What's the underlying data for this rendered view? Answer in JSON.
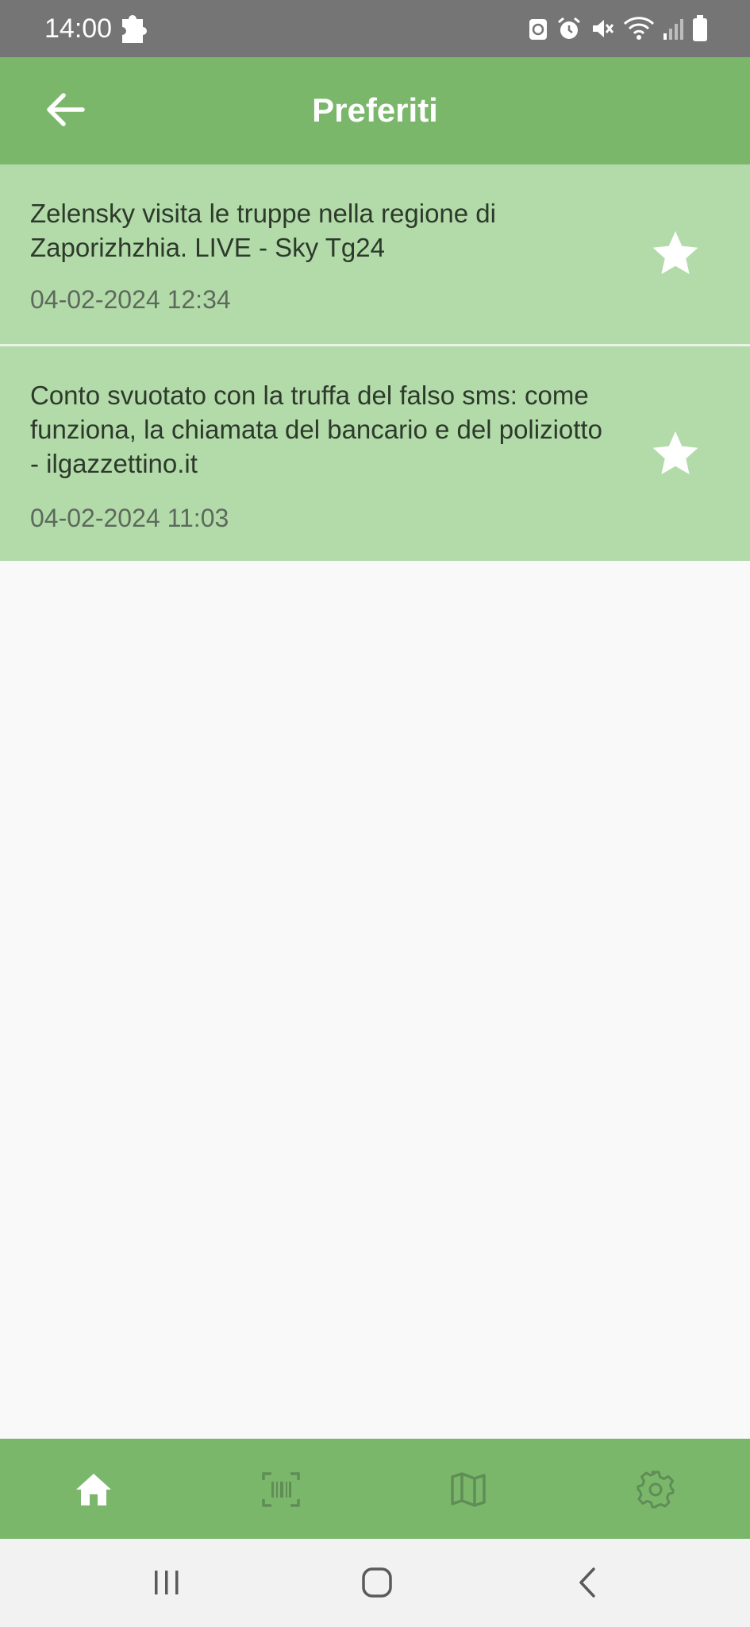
{
  "status_bar": {
    "time": "14:00",
    "icons": [
      "puzzle-icon",
      "recycle-icon",
      "alarm-icon",
      "mute-icon",
      "wifi-icon",
      "signal-icon",
      "battery-icon"
    ]
  },
  "app_bar": {
    "title": "Preferiti",
    "back_icon": "arrow-left-icon"
  },
  "favorites": [
    {
      "title": "Zelensky visita le truppe nella regione di Zaporizhzhia. LIVE - Sky Tg24",
      "date": "04-02-2024 12:34",
      "icon": "star-icon"
    },
    {
      "title": "Conto svuotato con la truffa del falso sms: come funziona, la chiamata del bancario e del poliziotto - ilgazzettino.it",
      "date": "04-02-2024 11:03",
      "icon": "star-icon"
    }
  ],
  "bottom_nav": {
    "items": [
      {
        "icon": "home-icon",
        "active": true
      },
      {
        "icon": "barcode-icon",
        "active": false
      },
      {
        "icon": "map-icon",
        "active": false
      },
      {
        "icon": "settings-icon",
        "active": false
      }
    ]
  },
  "system_nav": [
    "recents-icon",
    "home-circle-icon",
    "back-chevron-icon"
  ],
  "colors": {
    "status_bar": "#757575",
    "app_bar": "#7ab76b",
    "card": "#b3dbaa",
    "background": "#f9f9f9",
    "nav_active": "#ffffff",
    "nav_inactive": "#5f8d55"
  }
}
